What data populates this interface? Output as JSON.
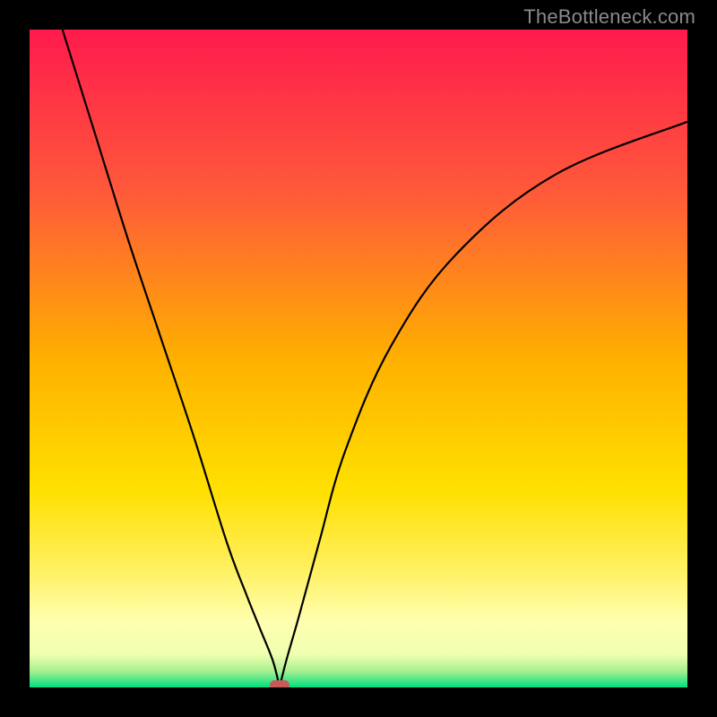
{
  "watermark": "TheBottleneck.com",
  "colors": {
    "frame": "#000000",
    "marker": "#c85a5a",
    "curve": "#000000",
    "gradient_stops": [
      {
        "pos": 0.0,
        "color": "#ff1a4d"
      },
      {
        "pos": 0.25,
        "color": "#ff5a3a"
      },
      {
        "pos": 0.5,
        "color": "#ffb000"
      },
      {
        "pos": 0.7,
        "color": "#ffe000"
      },
      {
        "pos": 0.82,
        "color": "#fff060"
      },
      {
        "pos": 0.9,
        "color": "#ffffb0"
      },
      {
        "pos": 0.95,
        "color": "#f0ffb0"
      },
      {
        "pos": 0.975,
        "color": "#a8f090"
      },
      {
        "pos": 1.0,
        "color": "#00e080"
      }
    ]
  },
  "chart_data": {
    "type": "line",
    "title": "",
    "xlabel": "",
    "ylabel": "",
    "xlim": [
      0,
      100
    ],
    "ylim": [
      0,
      100
    ],
    "min_point": {
      "x": 38,
      "y": 0
    },
    "series": [
      {
        "name": "curve",
        "x": [
          5,
          10,
          15,
          20,
          25,
          30,
          33,
          35,
          37,
          38,
          39,
          41,
          44,
          48,
          55,
          65,
          80,
          100
        ],
        "y": [
          100,
          84,
          68,
          53,
          38,
          22,
          14,
          9,
          4,
          0,
          4,
          11,
          22,
          36,
          52,
          66,
          78,
          86
        ]
      }
    ],
    "marker": {
      "x": 38,
      "y": 0,
      "shape": "rounded-rect"
    }
  }
}
